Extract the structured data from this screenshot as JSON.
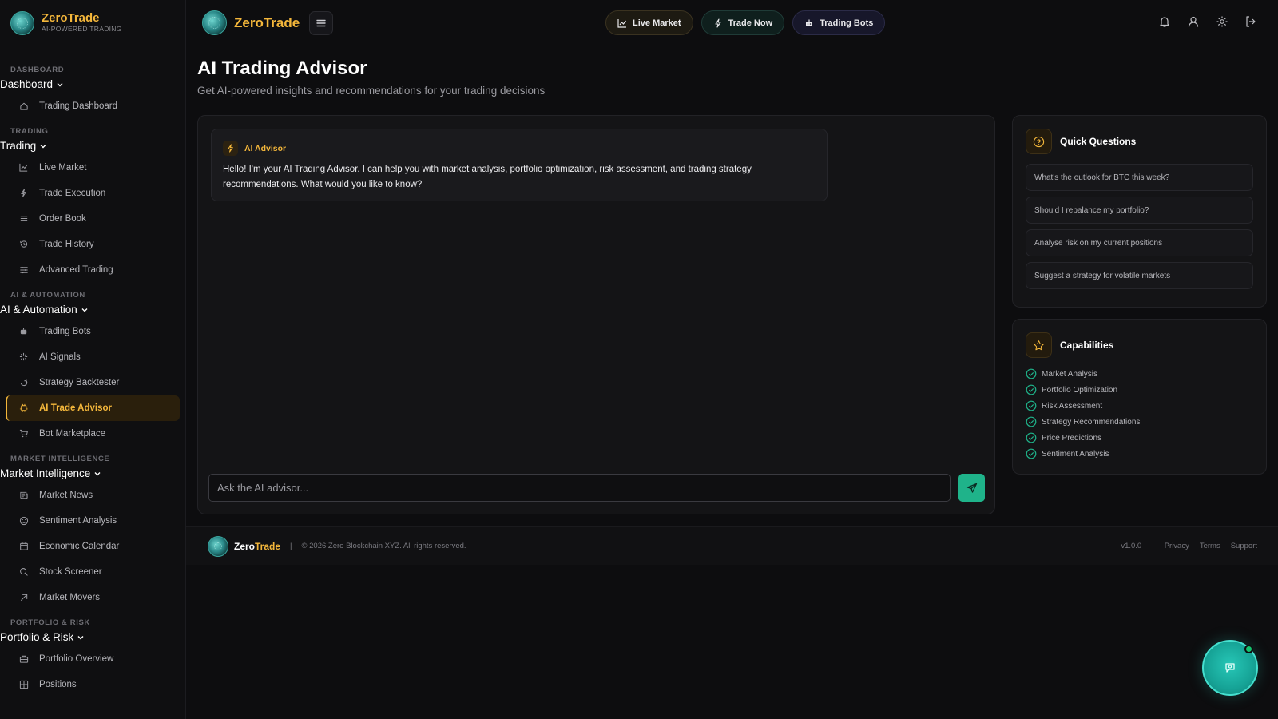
{
  "brand": {
    "name": "ZeroTrade",
    "tagline": "AI-POWERED TRADING"
  },
  "sidebar": {
    "groups": [
      {
        "section": "DASHBOARD",
        "toggle": "Dashboard",
        "items": [
          {
            "label": "Trading Dashboard",
            "icon": "home-icon"
          }
        ]
      },
      {
        "section": "TRADING",
        "toggle": "Trading",
        "items": [
          {
            "label": "Live Market",
            "icon": "chart-line-icon"
          },
          {
            "label": "Trade Execution",
            "icon": "bolt-icon"
          },
          {
            "label": "Order Book",
            "icon": "list-icon"
          },
          {
            "label": "Trade History",
            "icon": "history-icon"
          },
          {
            "label": "Advanced Trading",
            "icon": "sliders-icon"
          }
        ]
      },
      {
        "section": "AI & AUTOMATION",
        "toggle": "AI & Automation",
        "items": [
          {
            "label": "Trading Bots",
            "icon": "bot-icon"
          },
          {
            "label": "AI Signals",
            "icon": "sparkles-icon"
          },
          {
            "label": "Strategy Backtester",
            "icon": "refresh-icon"
          },
          {
            "label": "AI Trade Advisor",
            "icon": "chip-icon",
            "active": true
          },
          {
            "label": "Bot Marketplace",
            "icon": "cart-icon"
          }
        ]
      },
      {
        "section": "MARKET INTELLIGENCE",
        "toggle": "Market Intelligence",
        "items": [
          {
            "label": "Market News",
            "icon": "newspaper-icon"
          },
          {
            "label": "Sentiment Analysis",
            "icon": "smile-icon"
          },
          {
            "label": "Economic Calendar",
            "icon": "calendar-icon"
          },
          {
            "label": "Stock Screener",
            "icon": "search-icon"
          },
          {
            "label": "Market Movers",
            "icon": "arrow-up-right-icon"
          }
        ]
      },
      {
        "section": "PORTFOLIO & RISK",
        "toggle": "Portfolio & Risk",
        "items": [
          {
            "label": "Portfolio Overview",
            "icon": "briefcase-icon"
          },
          {
            "label": "Positions",
            "icon": "grid-icon"
          }
        ]
      }
    ]
  },
  "topbar": {
    "brand_name": "ZeroTrade",
    "pills": [
      {
        "label": "Live Market",
        "icon": "chart-line-icon"
      },
      {
        "label": "Trade Now",
        "icon": "bolt-icon"
      },
      {
        "label": "Trading Bots",
        "icon": "bot-icon"
      }
    ],
    "icons": [
      "bell-icon",
      "user-icon",
      "gear-icon",
      "logout-icon"
    ]
  },
  "page": {
    "title": "AI Trading Advisor",
    "subtitle": "Get AI-powered insights and recommendations for your trading decisions"
  },
  "chat": {
    "sender": "AI Advisor",
    "message": "Hello! I'm your AI Trading Advisor. I can help you with market analysis, portfolio optimization, risk assessment, and trading strategy recommendations. What would you like to know?",
    "input_placeholder": "Ask the AI advisor...",
    "input_value": ""
  },
  "quick_questions": {
    "title": "Quick Questions",
    "items": [
      "What's the outlook for BTC this week?",
      "Should I rebalance my portfolio?",
      "Analyse risk on my current positions",
      "Suggest a strategy for volatile markets"
    ]
  },
  "capabilities": {
    "title": "Capabilities",
    "items": [
      "Market Analysis",
      "Portfolio Optimization",
      "Risk Assessment",
      "Strategy Recommendations",
      "Price Predictions",
      "Sentiment Analysis"
    ]
  },
  "footer": {
    "name_part1": "Zero",
    "name_part2": "Trade",
    "separator": "|",
    "copyright": "© 2026 Zero Blockchain XYZ. All rights reserved.",
    "version": "v1.0.0",
    "links": [
      "Privacy",
      "Terms",
      "Support"
    ]
  },
  "colors": {
    "accent": "#f4b73b",
    "teal": "#1fb38a",
    "background": "#0d0d0f",
    "panel": "#141416"
  }
}
